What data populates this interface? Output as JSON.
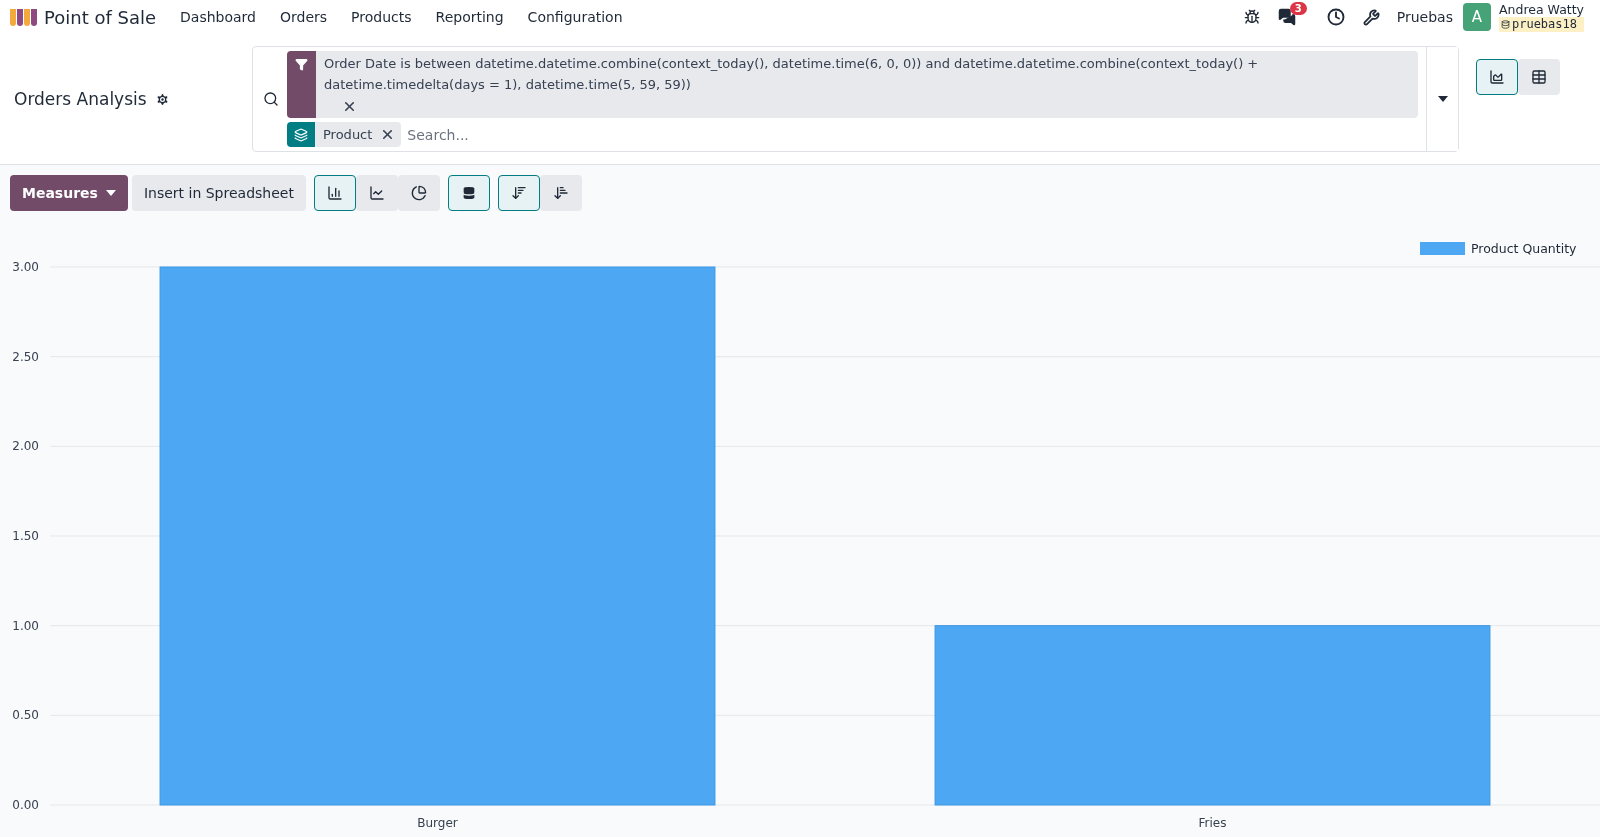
{
  "app": {
    "name": "Point of Sale"
  },
  "menu": [
    "Dashboard",
    "Orders",
    "Products",
    "Reporting",
    "Configuration"
  ],
  "systray": {
    "chat_badge": "3",
    "company": "Pruebas",
    "avatar_letter": "A",
    "user": "Andrea Watty",
    "database": "pruebas18"
  },
  "control_panel": {
    "title": "Orders Analysis",
    "facets": [
      {
        "kind": "filter",
        "value": "Order Date is between datetime.datetime.combine(context_today(), datetime.time(6, 0, 0)) and datetime.datetime.combine(context_today() + datetime.timedelta(days = 1), datetime.time(5, 59, 59))"
      },
      {
        "kind": "groupby",
        "value": "Product"
      }
    ],
    "search": {
      "placeholder": "Search..."
    },
    "views": [
      {
        "kind": "graph",
        "selected": true
      },
      {
        "kind": "pivot",
        "selected": false
      }
    ]
  },
  "toolbar": {
    "measures": "Measures",
    "insert": "Insert in Spreadsheet",
    "chart_types": [
      {
        "kind": "bar",
        "selected": true
      },
      {
        "kind": "line",
        "selected": false
      },
      {
        "kind": "pie",
        "selected": false
      }
    ],
    "stacked": {
      "selected": true
    },
    "sort": [
      {
        "kind": "descending",
        "selected": true
      },
      {
        "kind": "ascending",
        "selected": false
      }
    ]
  },
  "chart_data": {
    "type": "bar",
    "grid": true,
    "categories": [
      "Burger",
      "Fries"
    ],
    "series": [
      {
        "name": "Product Quantity",
        "color": "#4ea7f2",
        "values": [
          3,
          1
        ]
      }
    ],
    "ylim": [
      0,
      3
    ],
    "yticks": [
      {
        "value": 0,
        "label": "0.00"
      },
      {
        "value": 0.5,
        "label": "0.50"
      },
      {
        "value": 1,
        "label": "1.00"
      },
      {
        "value": 1.5,
        "label": "1.50"
      },
      {
        "value": 2,
        "label": "2.00"
      },
      {
        "value": 2.5,
        "label": "2.50"
      },
      {
        "value": 3,
        "label": "3.00"
      }
    ]
  }
}
